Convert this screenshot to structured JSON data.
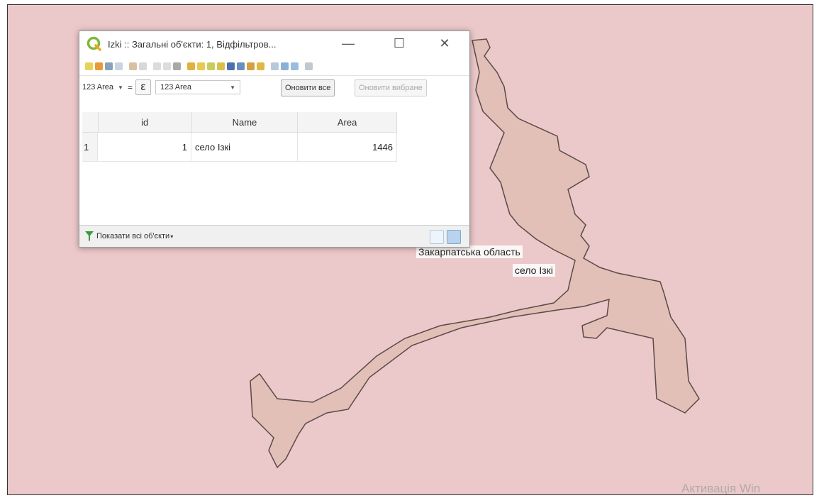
{
  "window": {
    "title": "Izki :: Загальні об'єкти: 1, Відфільтров...",
    "minimize_glyph": "—",
    "maximize_glyph": "☐",
    "close_glyph": "✕",
    "app_icon": "qgis-icon"
  },
  "expression_bar": {
    "field_selector": "123 Area",
    "epsilon_glyph": "ε",
    "field_combo": "123 Area",
    "update_all_label": "Оновити все",
    "update_selected_label": "Оновити вибране"
  },
  "table": {
    "columns": [
      "id",
      "Name",
      "Area"
    ],
    "rows": [
      {
        "row_number": "1",
        "id": "1",
        "name": "село Ізкі",
        "area": "1446"
      }
    ]
  },
  "status": {
    "show_all_label": "Показати всі об'єкти",
    "filter_icon": "filter-icon"
  },
  "map": {
    "label_region": "Закарпатська область",
    "label_village": "село Ізкі",
    "background_color": "#ebc8c9",
    "polygon_fill": "#e2c0b7",
    "polygon_stroke": "#5a4a48"
  },
  "watermark": "Активація Win"
}
